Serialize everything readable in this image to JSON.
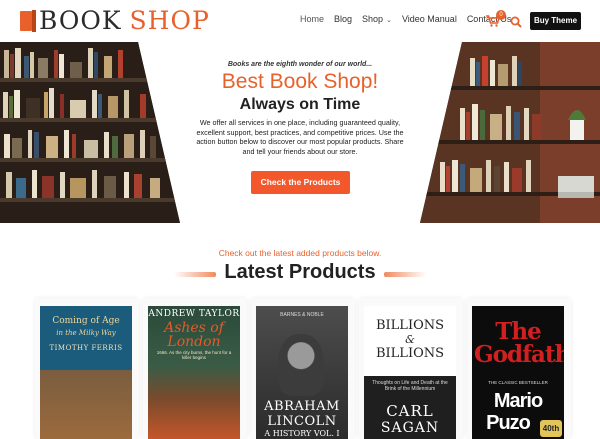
{
  "header": {
    "logo_dark": "BOOK",
    "logo_accent": "SHOP",
    "nav": [
      "Home",
      "Blog",
      "Shop",
      "Video Manual",
      "Contact Us"
    ],
    "cart_count": "0",
    "buy_button": "Buy Theme"
  },
  "hero": {
    "tagline": "Books are the eighth wonder of our world...",
    "title": "Best Book Shop!",
    "subtitle": "Always on Time",
    "description": "We offer all services in one place, including guaranteed quality, excellent support, best practices, and competitive prices. Use the action button below to discover our most popular products. Share and tell your friends about our store.",
    "cta": "Check the Products"
  },
  "latest": {
    "intro": "Check out the latest added products below.",
    "title": "Latest Products"
  },
  "products": [
    {
      "title_line1": "Coming of Age",
      "title_line2": "in the Milky Way",
      "author": "TIMOTHY FERRIS"
    },
    {
      "author": "ANDREW TAYLOR",
      "title_line1": "Ashes of",
      "title_line2": "London",
      "blurb": "1666. As the city burns, the hunt for a killer begins"
    },
    {
      "series": "BARNES & NOBLE",
      "title_line1": "ABRAHAM",
      "title_line2": "LINCOLN",
      "subtitle": "A HISTORY VOL. I"
    },
    {
      "title_line1": "BILLIONS",
      "amp": "&",
      "title_line2": "BILLIONS",
      "blurb": "Thoughts on Life and Death at the Brink of the Millennium",
      "author_first": "CARL",
      "author_last": "SAGAN"
    },
    {
      "title": "The Godfather",
      "label": "THE CLASSIC BESTSELLER",
      "author_first": "Mario",
      "author_last": "Puzo",
      "badge": "40th"
    }
  ],
  "colors": {
    "accent": "#e8612c",
    "button_dark": "#111111",
    "cta": "#f2582b"
  }
}
